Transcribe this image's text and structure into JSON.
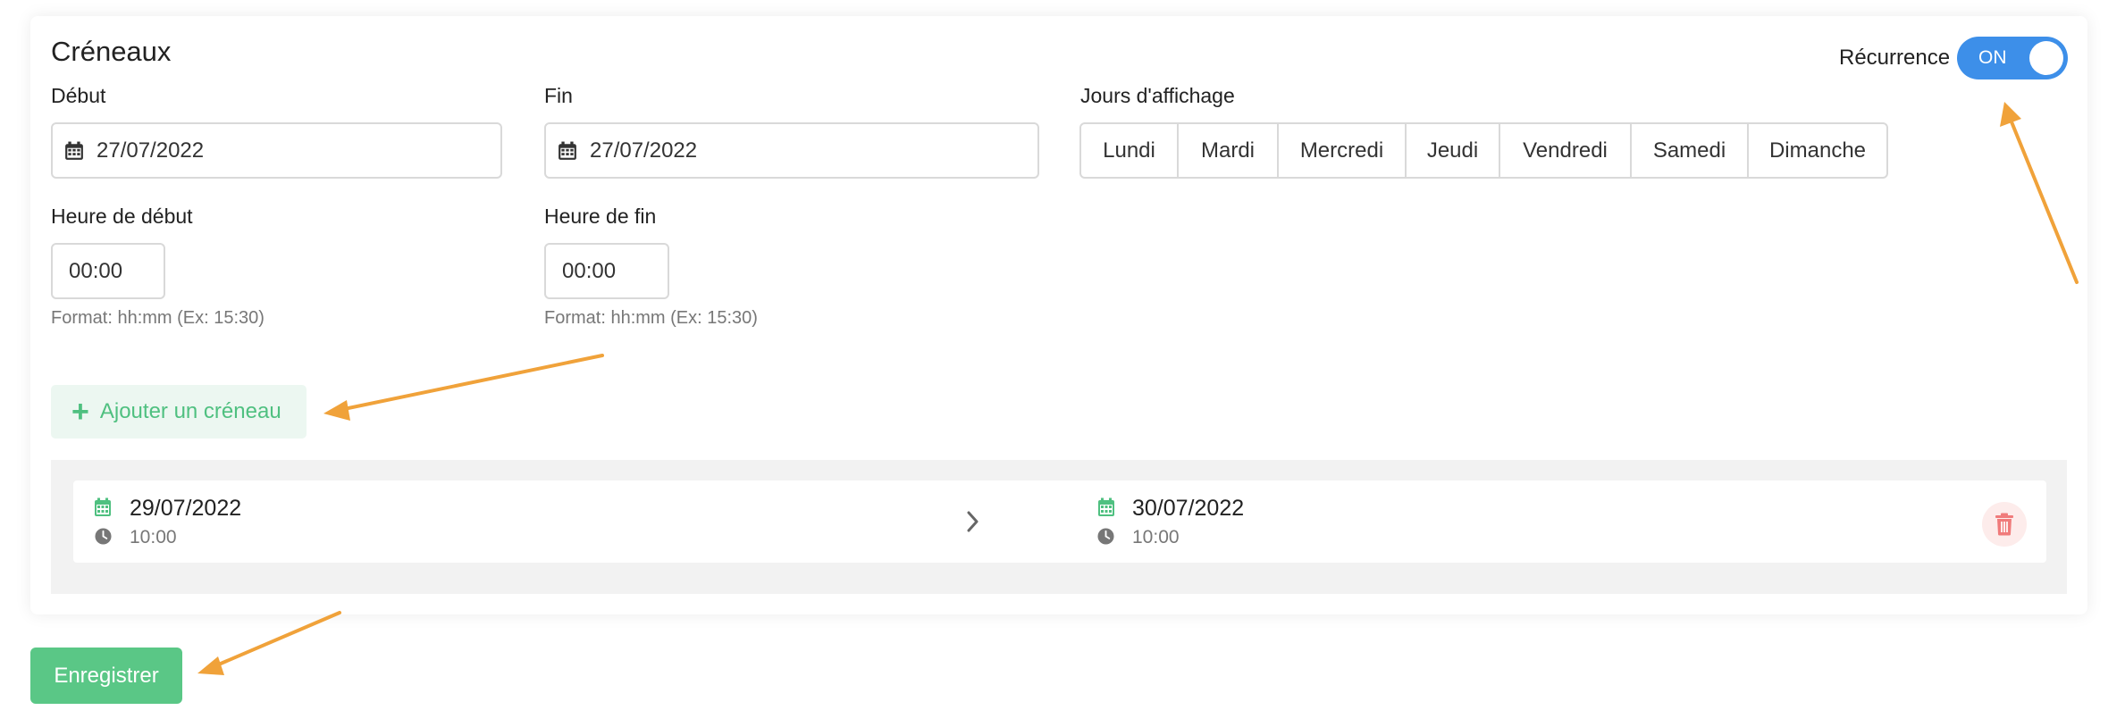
{
  "section": {
    "title": "Créneaux"
  },
  "recurrence": {
    "label": "Récurrence",
    "state": "ON"
  },
  "start_date": {
    "label": "Début",
    "value": "27/07/2022"
  },
  "end_date": {
    "label": "Fin",
    "value": "27/07/2022"
  },
  "display_days": {
    "label": "Jours d'affichage",
    "days": [
      "Lundi",
      "Mardi",
      "Mercredi",
      "Jeudi",
      "Vendredi",
      "Samedi",
      "Dimanche"
    ]
  },
  "start_time": {
    "label": "Heure de début",
    "value": "00:00",
    "hint": "Format: hh:mm (Ex: 15:30)"
  },
  "end_time": {
    "label": "Heure de fin",
    "value": "00:00",
    "hint": "Format: hh:mm (Ex: 15:30)"
  },
  "add_slot_button": {
    "label": "Ajouter un créneau"
  },
  "slots": [
    {
      "start_date": "29/07/2022",
      "start_time": "10:00",
      "end_date": "30/07/2022",
      "end_time": "10:00"
    }
  ],
  "save_button": {
    "label": "Enregistrer"
  },
  "colors": {
    "accent_green": "#5ac786",
    "toggle_blue": "#3d8fe9",
    "annotation_orange": "#f0a23a",
    "danger_red": "#f07b7b"
  }
}
